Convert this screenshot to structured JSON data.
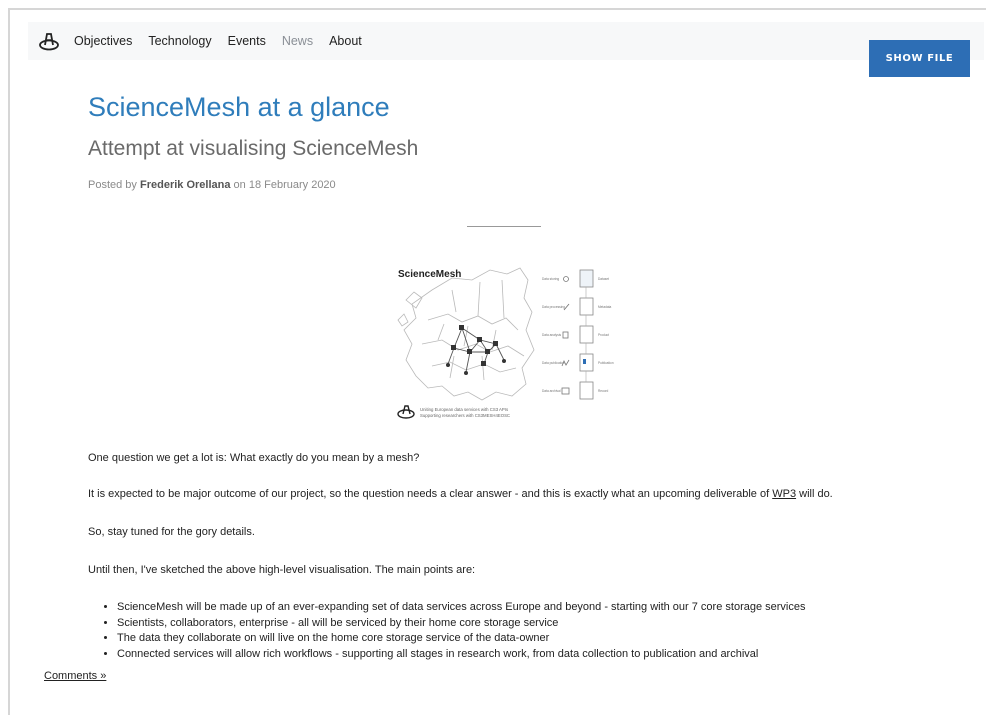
{
  "nav": {
    "items": [
      {
        "label": "Objectives"
      },
      {
        "label": "Technology"
      },
      {
        "label": "Events"
      },
      {
        "label": "News"
      },
      {
        "label": "About"
      }
    ]
  },
  "show_file_label": "SHOW FILE",
  "post": {
    "title": "ScienceMesh at a glance",
    "subtitle": "Attempt at visualising ScienceMesh",
    "posted_by_prefix": "Posted by ",
    "author": "Frederik Orellana",
    "date_text": " on 18 February 2020"
  },
  "figure": {
    "heading": "ScienceMesh",
    "caption_line1": "Uniting European data services with CS3 APIs",
    "caption_line2": "Supporting researchers with CS3MESH4EOSC",
    "steps": [
      {
        "label": "Data storing",
        "doc": "Dataset"
      },
      {
        "label": "Data processing",
        "doc": "Metadata"
      },
      {
        "label": "Data analysis",
        "doc": "Product"
      },
      {
        "label": "Data publication",
        "doc": "Publication"
      },
      {
        "label": "Data archival",
        "doc": "Record"
      }
    ]
  },
  "body": {
    "p1": "One question we get a lot is: What exactly do you mean by a mesh?",
    "p2_before": "It is expected to be major outcome of our project, so the question needs a clear answer - and this is exactly what an upcoming deliverable of ",
    "p2_link": "WP3",
    "p2_after": " will do.",
    "p3": "So, stay tuned for the gory details.",
    "p4": "Until then, I've sketched the above high-level visualisation. The main points are:",
    "points": [
      "ScienceMesh will be made up of an ever-expanding set of data services across Europe and beyond - starting with our 7 core storage services",
      "Scientists, collaborators, enterprise - all will be serviced by their home core storage service",
      "The data they collaborate on will live on the home core storage service of the data-owner",
      "Connected services will allow rich workflows - supporting all stages in research work, from data collection to publication and archival"
    ]
  },
  "comments_label": "Comments »"
}
